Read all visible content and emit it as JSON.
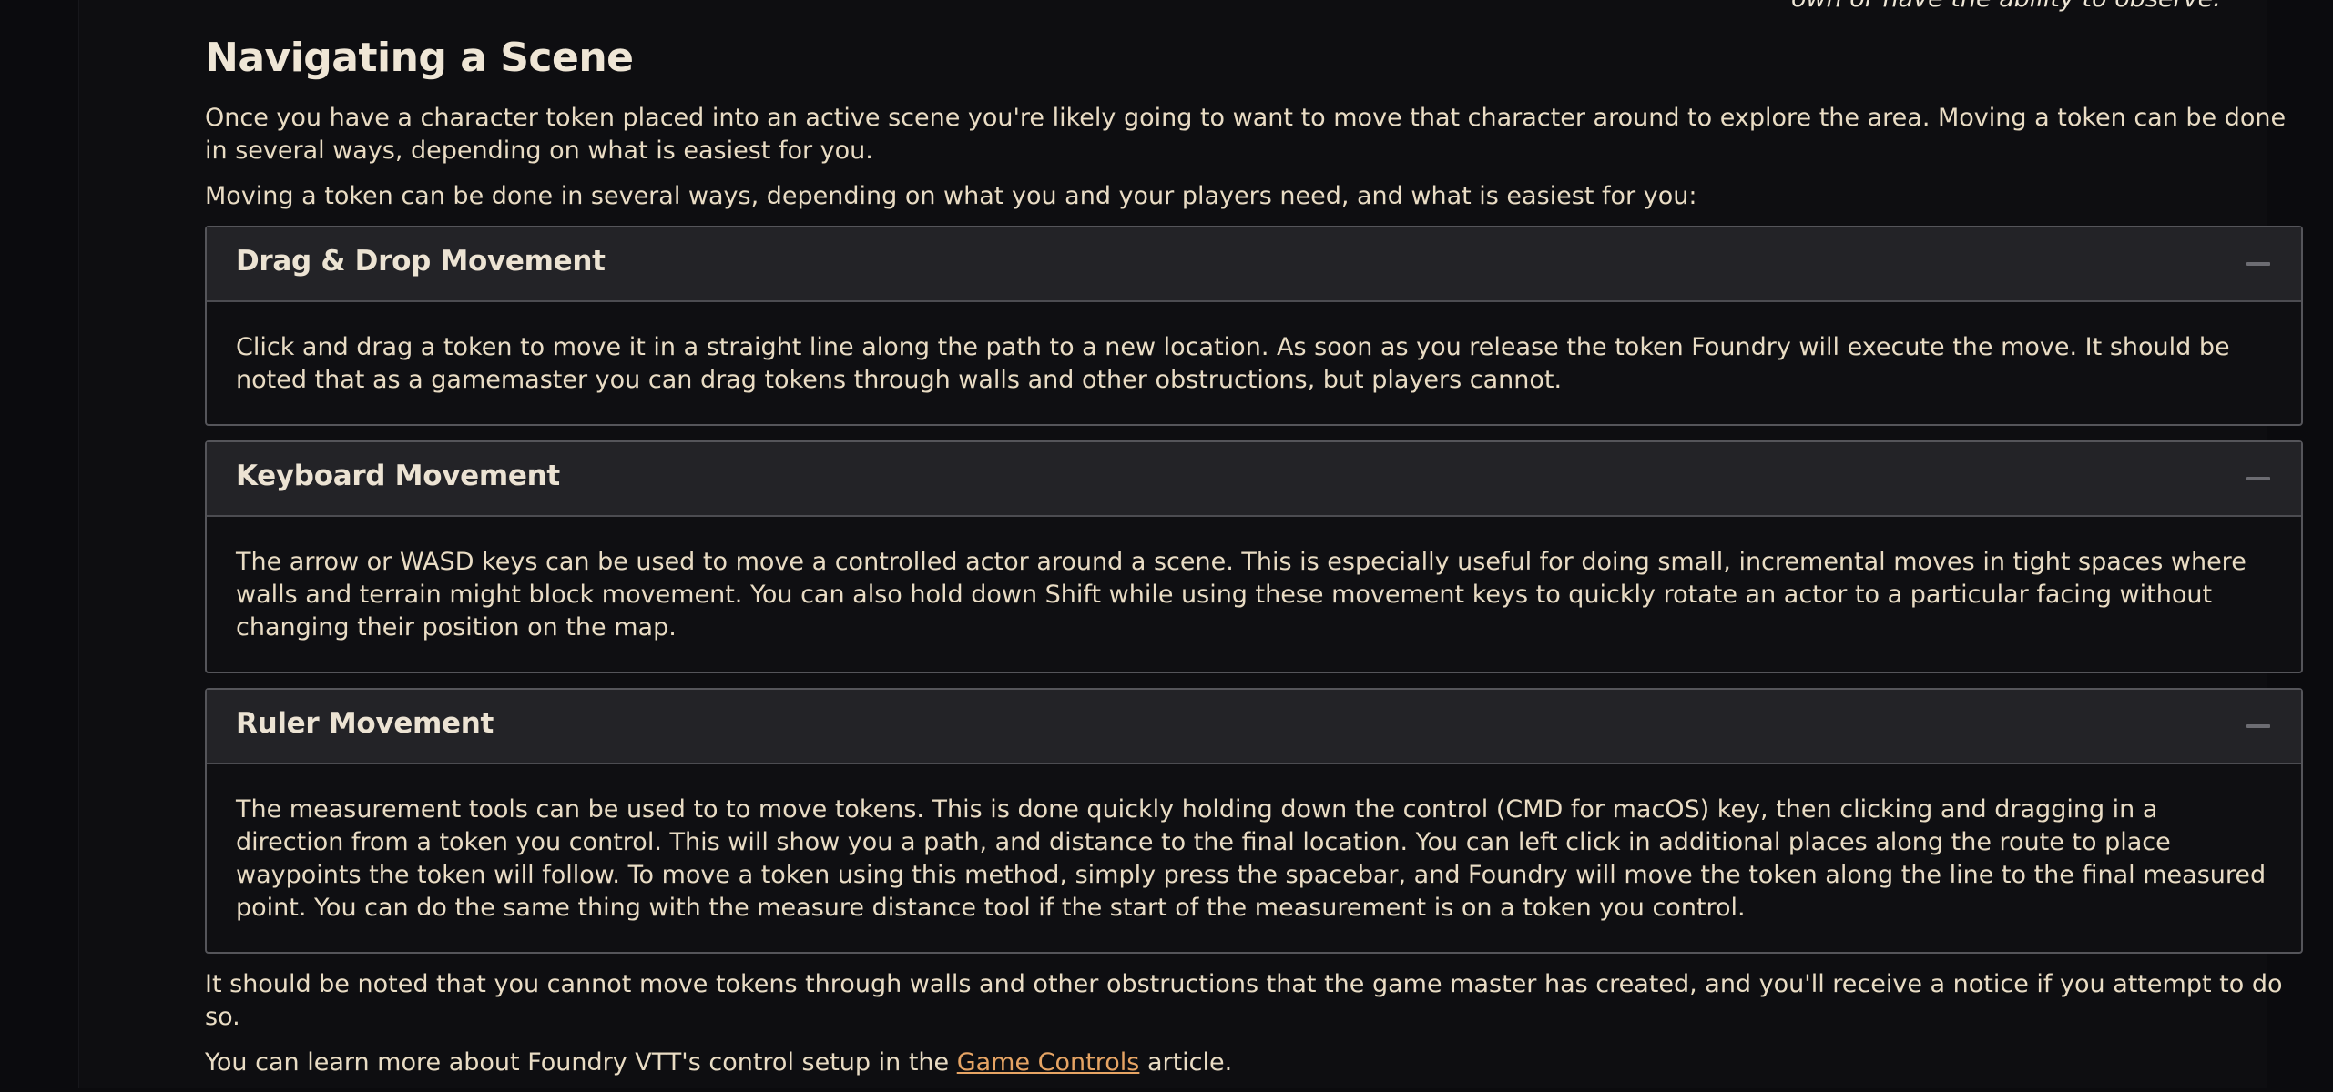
{
  "header_quote": {
    "line1": "own or have the ability to observe."
  },
  "section": {
    "title": "Navigating a Scene",
    "intro_1": "Once you have a character token placed into an active scene you're likely going to want to move that character around to explore the area. Moving a token can be done in several ways, depending on what is easiest for you.",
    "intro_2": "Moving a token can be done in several ways, depending on what you and your players need, and what is easiest for you:"
  },
  "panels": [
    {
      "title": "Drag & Drop Movement",
      "body": "Click and drag a token to move it in a straight line along the path to a new location. As soon as you release the token Foundry will execute the move. It should be noted that as a gamemaster you can drag tokens through walls and other obstructions, but players cannot."
    },
    {
      "title": "Keyboard Movement",
      "body": "The arrow or WASD keys can be used to move a controlled actor around a scene. This is especially useful for doing small, incremental moves in tight spaces where walls and terrain might block movement. You can also hold down Shift while using these movement keys to quickly rotate an actor to a particular facing without changing their position on the map."
    },
    {
      "title": "Ruler Movement",
      "body": "The measurement tools can be used to to move tokens. This is done quickly holding down the control (CMD for macOS) key, then clicking and dragging in a direction from a token you control. This will show you a path, and distance to the final location. You can left click in additional places along the route to place waypoints the token will follow. To move a token using this method, simply press the spacebar, and Foundry will move the token along the line to the final measured point. You can do the same thing with the measure distance tool if the start of the measurement is on a token you control."
    }
  ],
  "footer": {
    "note": "It should be noted that you cannot move tokens through walls and other obstructions that the game master has created, and you'll receive a notice if you attempt to do so.",
    "learn_prefix": "You can learn more about Foundry VTT's control setup in the ",
    "learn_link": "Game Controls",
    "learn_suffix": " article."
  },
  "colors": {
    "background": "#0b0b0e",
    "text": "#e9dcc4",
    "link": "#e6a464",
    "panel_header": "#232327",
    "panel_border": "#55555a"
  },
  "icons": {
    "collapse": "minus-icon"
  }
}
